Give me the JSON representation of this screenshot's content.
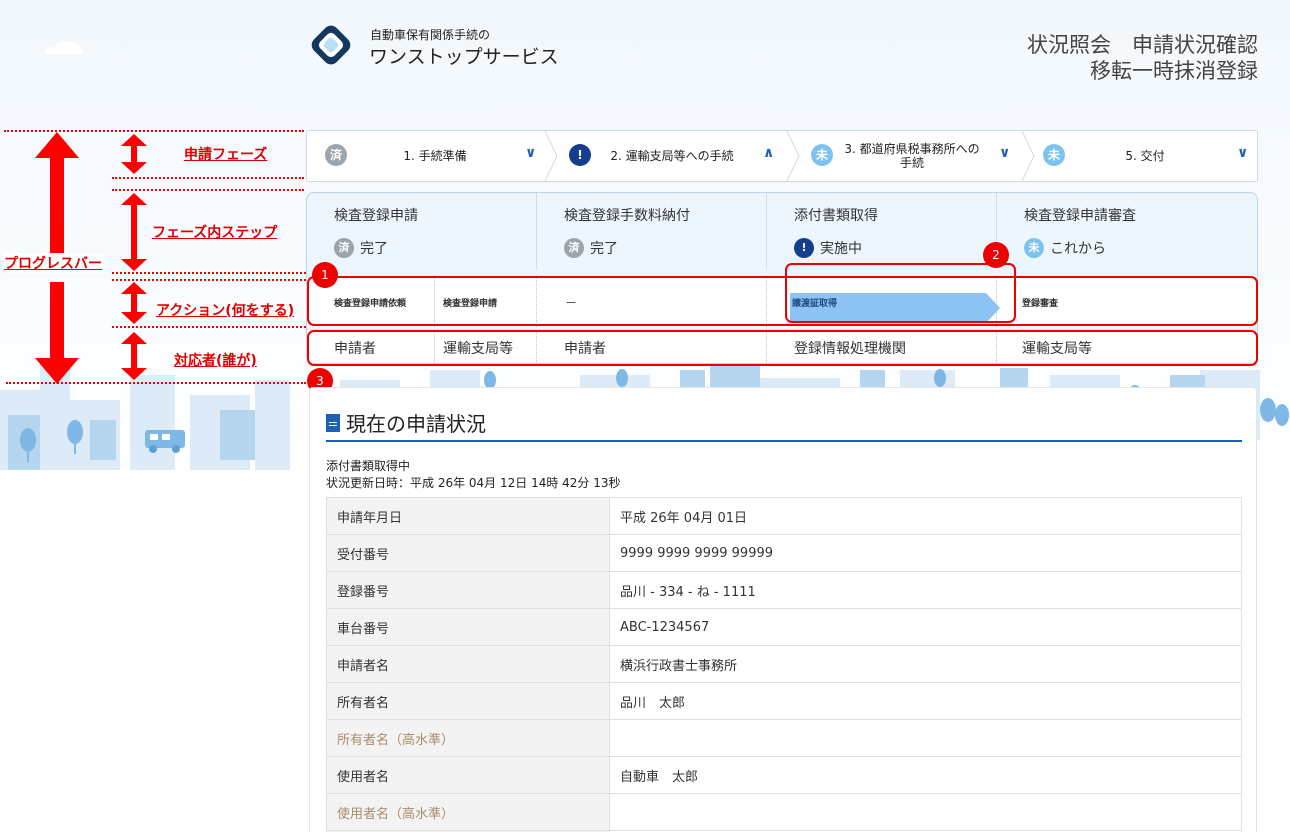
{
  "header": {
    "logo_line1": "自動車保有関係手続の",
    "logo_line2": "ワンストップサービス",
    "title_line1": "状況照会　申請状況確認",
    "title_line2": "移転一時抹消登録"
  },
  "annotations": {
    "progress_bar": "プログレスバー",
    "phase": "申請フェーズ",
    "steps": "フェーズ内ステップ",
    "action": "アクション(何をする)",
    "actor": "対応者(誰が)",
    "markers": [
      "1",
      "2",
      "3"
    ]
  },
  "phases": [
    {
      "icon": "済",
      "label": "1. 手続準備",
      "chevron": "∨",
      "state": "done"
    },
    {
      "icon": "!",
      "label": "2. 運輸支局等への手続",
      "chevron": "∧",
      "state": "current"
    },
    {
      "icon": "未",
      "label": "3. 都道府県税事務所への手続",
      "chevron": "∨",
      "state": "todo"
    },
    {
      "icon": "未",
      "label": "5. 交付",
      "chevron": "∨",
      "state": "todo"
    }
  ],
  "steps": [
    {
      "name": "検査登録申請",
      "status_icon": "済",
      "status": "完了",
      "state": "done",
      "actions": [
        "検査登録申請依頼",
        "検査登録申請"
      ],
      "actors": [
        "申請者",
        "運輸支局等"
      ]
    },
    {
      "name": "検査登録手数料納付",
      "status_icon": "済",
      "status": "完了",
      "state": "done",
      "actions": [
        "－"
      ],
      "actors": [
        "申請者"
      ]
    },
    {
      "name": "添付書類取得",
      "status_icon": "!",
      "status": "実施中",
      "state": "current",
      "actions": [
        "譲渡証取得"
      ],
      "actors": [
        "登録情報処理機関"
      ]
    },
    {
      "name": "検査登録申請審査",
      "status_icon": "未",
      "status": "これから",
      "state": "todo",
      "actions": [
        "登録審査"
      ],
      "actors": [
        "運輸支局等"
      ]
    }
  ],
  "panel": {
    "title": "現在の申請状況",
    "status": "添付書類取得中",
    "updated": "状況更新日時：平成 26年 04月 12日 14時 42分 13秒",
    "rows": [
      {
        "label": "申請年月日",
        "value": "平成 26年 04月 01日",
        "dim": false
      },
      {
        "label": "受付番号",
        "value": "9999 9999 9999 99999",
        "dim": false
      },
      {
        "label": "登録番号",
        "value": "品川 - 334 - ね - 1111",
        "dim": false
      },
      {
        "label": "車台番号",
        "value": "ABC-1234567",
        "dim": false
      },
      {
        "label": "申請者名",
        "value": "横浜行政書士事務所",
        "dim": false
      },
      {
        "label": "所有者名",
        "value": "品川　太郎",
        "dim": false
      },
      {
        "label": "所有者名（高水準）",
        "value": "",
        "dim": true
      },
      {
        "label": "使用者名",
        "value": "自動車　太郎",
        "dim": false
      },
      {
        "label": "使用者名（高水準）",
        "value": "",
        "dim": true
      },
      {
        "label": "",
        "value": "",
        "dim": false
      }
    ]
  },
  "colors": {
    "done": "#9aa5ad",
    "current": "#153f8c",
    "todo": "#7ec3ef",
    "accent": "#1e62b8",
    "annotation": "#e00000"
  }
}
